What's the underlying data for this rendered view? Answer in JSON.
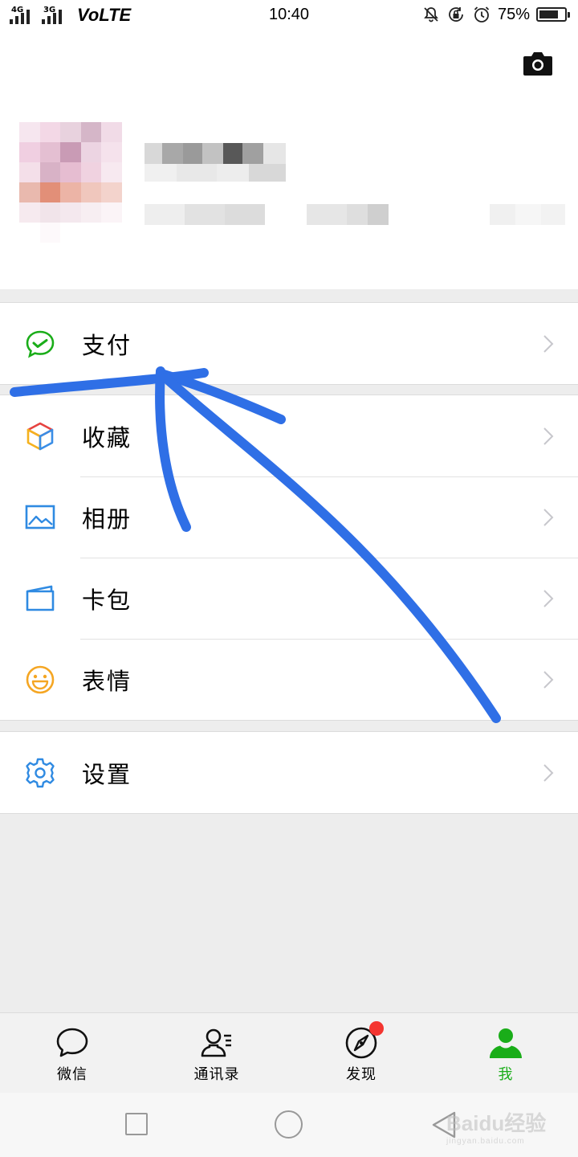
{
  "status_bar": {
    "network_1": "4G",
    "network_2": "3G",
    "volte": "VoLTE",
    "time": "10:40",
    "battery_percent": "75%",
    "battery_level": 0.75,
    "icons": [
      "mute-icon",
      "rotation-lock-icon",
      "alarm-icon"
    ]
  },
  "profile": {
    "camera_icon": "camera-icon"
  },
  "menu": {
    "pay": {
      "label": "支付",
      "icon": "wechat-pay-icon"
    },
    "items": [
      {
        "label": "收藏",
        "icon": "favorites-cube-icon"
      },
      {
        "label": "相册",
        "icon": "album-icon"
      },
      {
        "label": "卡包",
        "icon": "card-wallet-icon"
      },
      {
        "label": "表情",
        "icon": "sticker-smile-icon"
      }
    ],
    "settings": {
      "label": "设置",
      "icon": "gear-icon"
    }
  },
  "tabbar": {
    "tabs": [
      {
        "label": "微信",
        "icon": "chat-bubble-icon",
        "active": false
      },
      {
        "label": "通讯录",
        "icon": "contacts-icon",
        "active": false
      },
      {
        "label": "发现",
        "icon": "compass-icon",
        "active": false,
        "badge": true
      },
      {
        "label": "我",
        "icon": "person-icon",
        "active": true
      }
    ]
  },
  "colors": {
    "active": "#1aad19",
    "badge": "#f43530",
    "annotation": "#2f6fe6"
  },
  "watermark": {
    "main": "Baidu经验",
    "sub": "jingyan.baidu.com"
  }
}
